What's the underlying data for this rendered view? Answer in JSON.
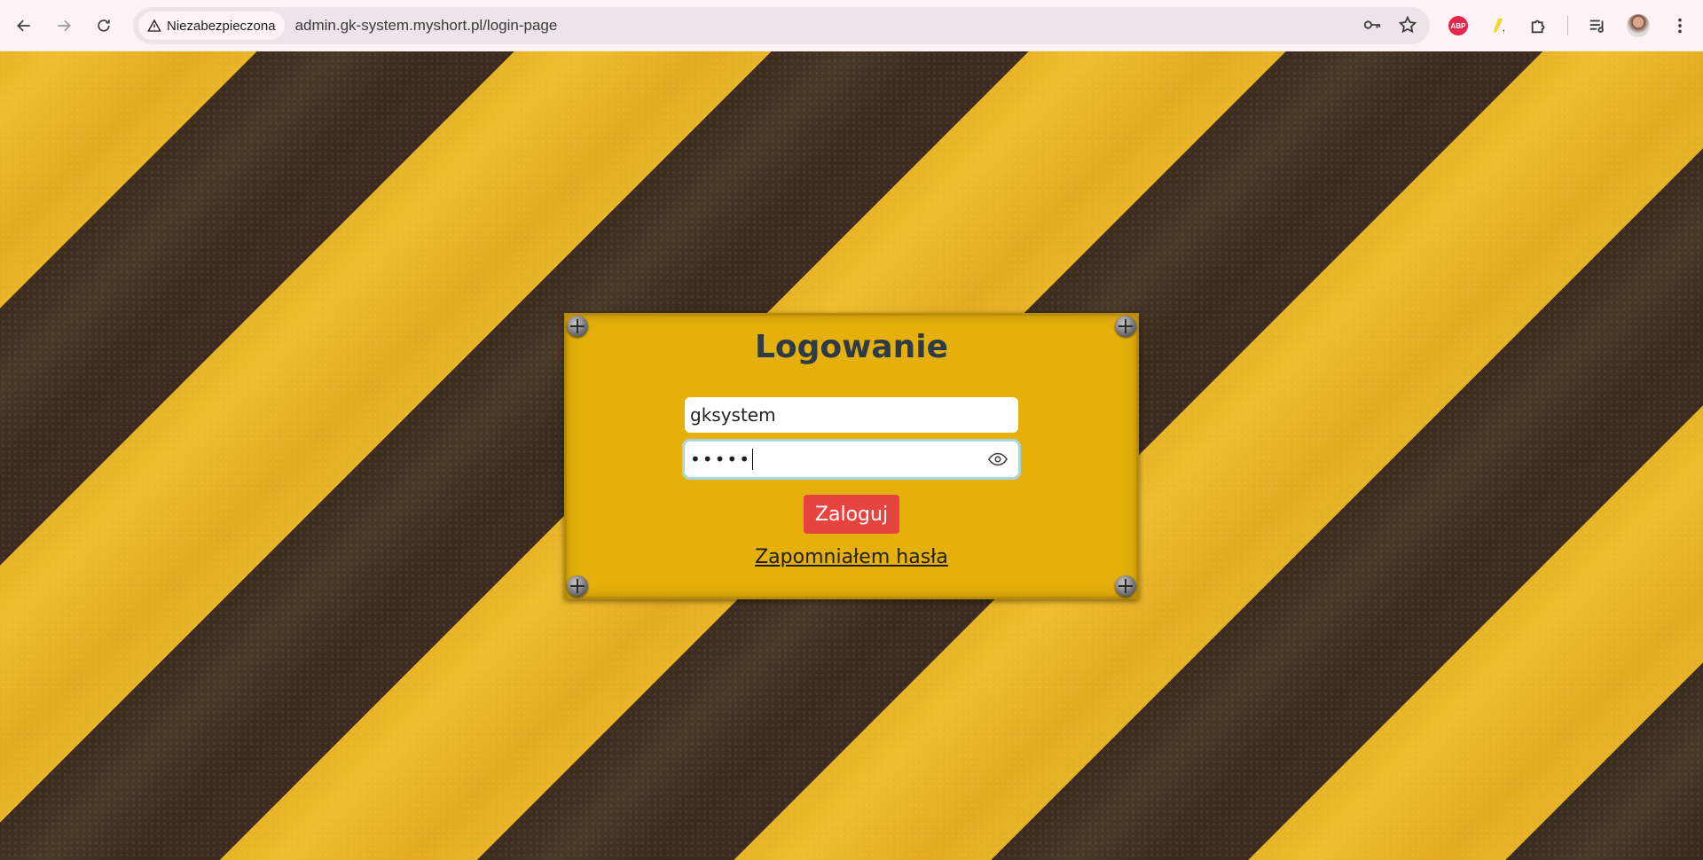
{
  "browser": {
    "security_label": "Niezabezpieczona",
    "url": "admin.gk-system.myshort.pl/login-page",
    "icons": [
      "back-icon",
      "forward-icon",
      "reload-icon",
      "warning-icon",
      "key-icon",
      "star-icon",
      "adblock-icon",
      "extension-icon",
      "puzzle-icon",
      "media-icon",
      "avatar",
      "menu-icon"
    ],
    "abp_label": "ABP"
  },
  "login": {
    "title": "Logowanie",
    "username_value": "gksystem",
    "password_mask": "•••••",
    "submit_label": "Zaloguj",
    "forgot_label": "Zapomniałem hasła"
  },
  "colors": {
    "plate": "#e6b00b",
    "button": "#e8443f",
    "title": "#2e3a46",
    "stripe_yellow": "#e8b326",
    "stripe_dark": "#3b2c1f"
  }
}
